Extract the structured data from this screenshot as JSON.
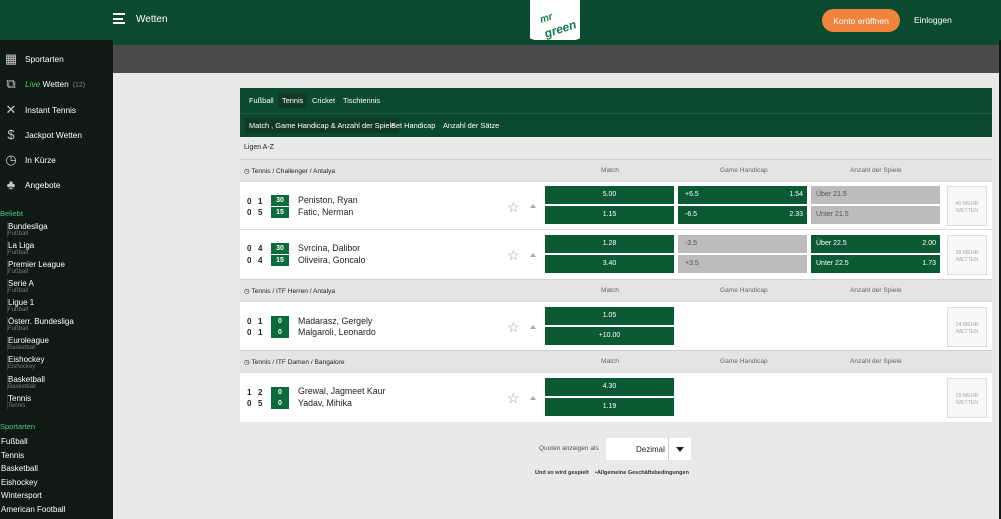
{
  "header": {
    "title": "Wetten",
    "logo_line1": "mr",
    "logo_line2": "green",
    "register": "Konto eröffnen",
    "login": "Einloggen"
  },
  "sidebar": {
    "items": [
      {
        "icon": "grid-icon",
        "label": "Sportarten"
      },
      {
        "icon": "live-tv-icon",
        "label_live": "Live",
        "label": "Wetten",
        "count": "(12)"
      },
      {
        "icon": "tennis-rackets-icon",
        "label": "Instant Tennis"
      },
      {
        "icon": "money-bag-icon",
        "label": "Jackpot Wetten"
      },
      {
        "icon": "stopwatch-icon",
        "label": "In Kürze"
      },
      {
        "icon": "tree-icon",
        "label": "Angebote"
      }
    ],
    "beliebt_title": "Beliebt",
    "beliebt": [
      {
        "name": "Bundesliga",
        "sport": "Fußball"
      },
      {
        "name": "La Liga",
        "sport": "Fußball"
      },
      {
        "name": "Premier League",
        "sport": "Fußball"
      },
      {
        "name": "Serie A",
        "sport": "Fußball"
      },
      {
        "name": "Ligue 1",
        "sport": "Fußball"
      },
      {
        "name": "Österr. Bundesliga",
        "sport": "Fußball"
      },
      {
        "name": "Euroleague",
        "sport": "Basketball"
      },
      {
        "name": "Eishockey",
        "sport": "Eishockey"
      },
      {
        "name": "Basketball",
        "sport": "Basketball"
      },
      {
        "name": "Tennis",
        "sport": "Tennis"
      }
    ],
    "sportarten_title": "Sportarten",
    "sportarten": [
      "Fußball",
      "Tennis",
      "Basketball",
      "Eishockey",
      "Wintersport",
      "American Football"
    ]
  },
  "sport_tabs": [
    "Fußball",
    "Tennis",
    "Cricket",
    "Tischtennis"
  ],
  "market_tabs": [
    "Match , Game Handicap & Anzahl der Spiele",
    "Set Handicap",
    "Anzahl der Sätze"
  ],
  "ligen": "Ligen A-Z",
  "columns": {
    "match": "Match",
    "handicap": "Game Handicap",
    "anzahl": "Anzahl der Spiele"
  },
  "sections": [
    {
      "title": "Tennis / Challenger / Antalya"
    },
    {
      "title": "Tennis / ITF Herren / Antalya"
    },
    {
      "title": "Tennis / ITF Damen / Bangalore"
    }
  ],
  "matches": [
    {
      "p1": "Peniston, Ryan",
      "p2": "Fatic, Nerman",
      "s1": [
        "0",
        "1"
      ],
      "s2": [
        "0",
        "5"
      ],
      "g1": "30",
      "g2": "15",
      "m1": "5.00",
      "m2": "1.15",
      "h1l": "+6.5",
      "h1r": "1.54",
      "h2l": "-6.5",
      "h2r": "2.33",
      "a1l": "Über 21.5",
      "a2l": "Unter 21.5",
      "mehr_count": "40",
      "mehr_label": "MEHR WETTEN"
    },
    {
      "p1": "Svrcina, Dalibor",
      "p2": "Oliveira, Goncalo",
      "s1": [
        "0",
        "4"
      ],
      "s2": [
        "0",
        "4"
      ],
      "g1": "30",
      "g2": "15",
      "m1": "1.28",
      "m2": "3.40",
      "h1l": "-3.5",
      "h2l": "+3.5",
      "a1l": "Über 22.5",
      "a1r": "2.00",
      "a2l": "Unter 22.5",
      "a2r": "1.73",
      "mehr_count": "38",
      "mehr_label": "MEHR WETTEN"
    },
    {
      "p1": "Madarasz, Gergely",
      "p2": "Malgaroli, Leonardo",
      "s1": [
        "0",
        "1"
      ],
      "s2": [
        "0",
        "1"
      ],
      "g1": "0",
      "g2": "0",
      "m1": "1.05",
      "m2": "+10.00",
      "mehr_count": "14",
      "mehr_label": "MEHR WETTEN"
    },
    {
      "p1": "Grewal, Jagmeet Kaur",
      "p2": "Yadav, Mihika",
      "s1": [
        "1",
        "2"
      ],
      "s2": [
        "0",
        "5"
      ],
      "g1": "0",
      "g2": "0",
      "m1": "4.30",
      "m2": "1.19",
      "mehr_count": "18",
      "mehr_label": "MEHR WETTEN"
    }
  ],
  "quoten": {
    "label": "Quoten anzeigen als",
    "value": "Dezimal"
  },
  "footer": {
    "link1": "Und so wird gespielt",
    "link2": "Allgemeine Geschäftsbedingungen"
  }
}
